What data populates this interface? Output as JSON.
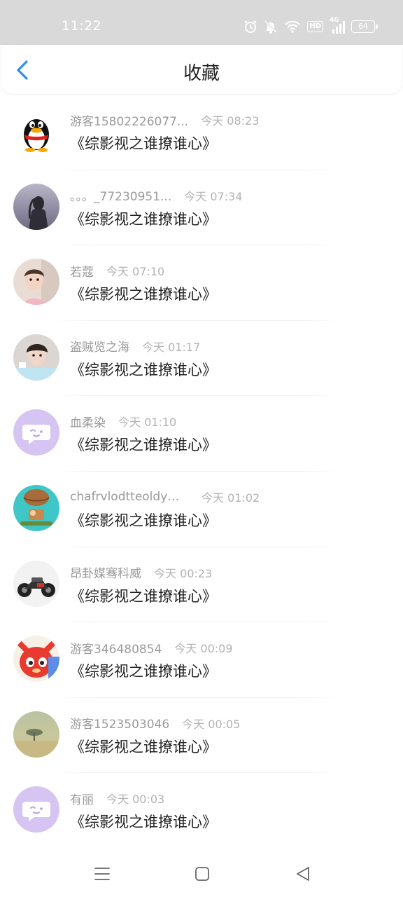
{
  "status_bar": {
    "time": "11:22",
    "hd_label": "HD",
    "network_label": "4G",
    "battery": "64"
  },
  "header": {
    "back_icon": "chevron-left-icon",
    "title": "收藏",
    "accent_color": "#2d8cf0"
  },
  "favorites": [
    {
      "username": "游客15802226077...",
      "time": "今天 08:23",
      "title": "《综影视之谁撩谁心》",
      "avatar": "penguin-avatar"
    },
    {
      "username": "。。。_77230951...",
      "time": "今天 07:34",
      "title": "《综影视之谁撩谁心》",
      "avatar": "girl-photo-avatar"
    },
    {
      "username": "若蔻",
      "time": "今天 07:10",
      "title": "《综影视之谁撩谁心》",
      "avatar": "child-photo-avatar"
    },
    {
      "username": "盗贼览之海",
      "time": "今天 01:17",
      "title": "《综影视之谁撩谁心》",
      "avatar": "boy-photo-avatar"
    },
    {
      "username": "血柔染",
      "time": "今天 01:10",
      "title": "《综影视之谁撩谁心》",
      "avatar": "default-chat-avatar"
    },
    {
      "username": "chafrvlodtteoldym...",
      "time": "今天 01:02",
      "title": "《综影视之谁撩谁心》",
      "avatar": "cartoon-balloon-avatar"
    },
    {
      "username": "昂卦媒骞科威",
      "time": "今天 00:23",
      "title": "《综影视之谁撩谁心》",
      "avatar": "motorcycle-photo-avatar"
    },
    {
      "username": "游客346480854",
      "time": "今天 00:09",
      "title": "《综影视之谁撩谁心》",
      "avatar": "red-fox-cartoon-avatar"
    },
    {
      "username": "游客1523503046",
      "time": "今天 00:05",
      "title": "《综影视之谁撩谁心》",
      "avatar": "landscape-tree-avatar"
    },
    {
      "username": "有丽",
      "time": "今天 00:03",
      "title": "《综影视之谁撩谁心》",
      "avatar": "default-chat-avatar"
    }
  ],
  "nav_bar": {
    "menu_icon": "menu-icon",
    "home_icon": "home-square-icon",
    "back_icon": "back-triangle-icon"
  }
}
